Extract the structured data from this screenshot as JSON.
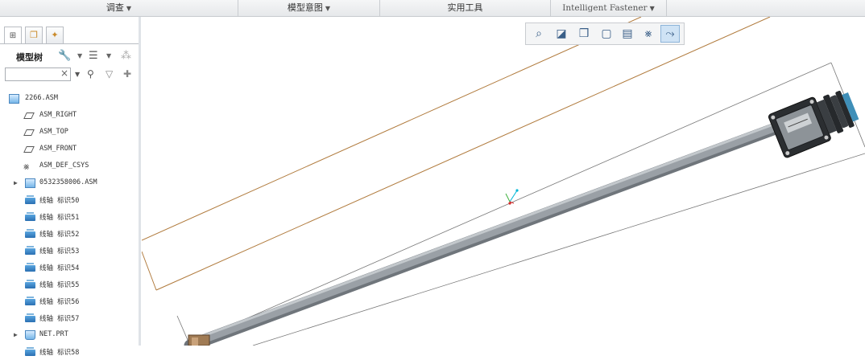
{
  "ribbon": {
    "groups": [
      {
        "label": "调查",
        "has_dropdown": true
      },
      {
        "label": "模型意图",
        "has_dropdown": true
      },
      {
        "label": "实用工具",
        "has_dropdown": false
      },
      {
        "label": "Intelligent Fastener",
        "has_dropdown": true
      }
    ]
  },
  "left_panel": {
    "tabs": [
      {
        "icon": "model-tree-tab-icon",
        "active": true
      },
      {
        "icon": "folder-browser-tab-icon",
        "active": false
      },
      {
        "icon": "favorites-tab-icon",
        "active": false
      }
    ],
    "title": "模型树",
    "search": {
      "value": "",
      "placeholder": ""
    },
    "tree": [
      {
        "label": "2266.ASM",
        "icon": "assembly-icon",
        "level": 0,
        "expandable": false
      },
      {
        "label": "ASM_RIGHT",
        "icon": "datum-plane-icon",
        "level": 1,
        "expandable": false
      },
      {
        "label": "ASM_TOP",
        "icon": "datum-plane-icon",
        "level": 1,
        "expandable": false
      },
      {
        "label": "ASM_FRONT",
        "icon": "datum-plane-icon",
        "level": 1,
        "expandable": false
      },
      {
        "label": "ASM_DEF_CSYS",
        "icon": "csys-icon",
        "level": 1,
        "expandable": false
      },
      {
        "label": "0532358006.ASM",
        "icon": "assembly-icon",
        "level": 1,
        "expandable": true
      },
      {
        "label": "线轴 标识50",
        "icon": "spool-icon",
        "level": 1,
        "expandable": false
      },
      {
        "label": "线轴 标识51",
        "icon": "spool-icon",
        "level": 1,
        "expandable": false
      },
      {
        "label": "线轴 标识52",
        "icon": "spool-icon",
        "level": 1,
        "expandable": false
      },
      {
        "label": "线轴 标识53",
        "icon": "spool-icon",
        "level": 1,
        "expandable": false
      },
      {
        "label": "线轴 标识54",
        "icon": "spool-icon",
        "level": 1,
        "expandable": false
      },
      {
        "label": "线轴 标识55",
        "icon": "spool-icon",
        "level": 1,
        "expandable": false
      },
      {
        "label": "线轴 标识56",
        "icon": "spool-icon",
        "level": 1,
        "expandable": false
      },
      {
        "label": "线轴 标识57",
        "icon": "spool-icon",
        "level": 1,
        "expandable": false
      },
      {
        "label": "NET.PRT",
        "icon": "part-icon",
        "level": 1,
        "expandable": true
      },
      {
        "label": "线轴 标识58",
        "icon": "spool-icon",
        "level": 1,
        "expandable": false
      }
    ]
  },
  "view_toolbar": {
    "buttons": [
      {
        "name": "zoom-fit-icon",
        "active": false
      },
      {
        "name": "repaint-icon",
        "active": false
      },
      {
        "name": "display-style-icon",
        "active": false
      },
      {
        "name": "saved-views-icon",
        "active": false
      },
      {
        "name": "view-manager-icon",
        "active": false
      },
      {
        "name": "datum-display-icon",
        "active": false
      },
      {
        "name": "spin-center-icon",
        "active": true
      }
    ]
  },
  "colors": {
    "datum_plane": "#b07a3c",
    "cable": "#8a9096",
    "connector": "#2b2e31",
    "accent": "#3a7fc0"
  }
}
